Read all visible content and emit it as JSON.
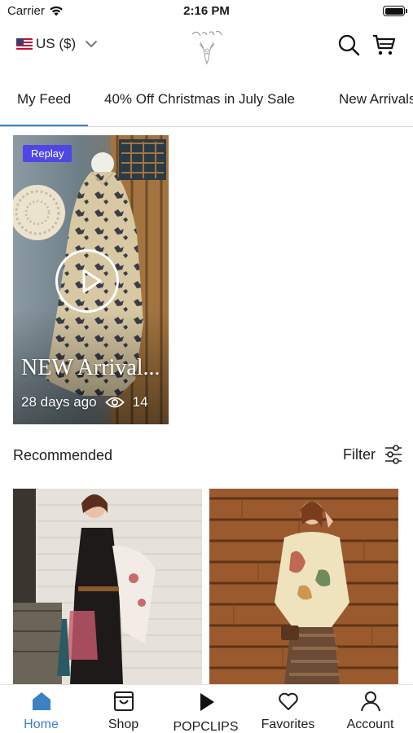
{
  "status_bar": {
    "carrier": "Carrier",
    "time": "2:16 PM"
  },
  "header": {
    "currency": "US ($)",
    "icons": [
      "flag-us-icon",
      "chevron-down-icon",
      "logo-icon",
      "search-icon",
      "cart-icon"
    ]
  },
  "tabs": [
    {
      "label": "My Feed",
      "active": true
    },
    {
      "label": "40% Off Christmas in July Sale",
      "active": false
    },
    {
      "label": "New Arrivals",
      "active": false
    }
  ],
  "replay": {
    "badge": "Replay",
    "title": "NEW Arrival...",
    "age": "28 days ago",
    "views": "14"
  },
  "recommended": {
    "title": "Recommended",
    "filter_label": "Filter"
  },
  "bottom_nav": [
    {
      "label": "Home",
      "icon": "home-icon",
      "active": true
    },
    {
      "label": "Shop",
      "icon": "shop-icon",
      "active": false
    },
    {
      "label": "POPCLIPS",
      "icon": "play-icon",
      "active": false
    },
    {
      "label": "Favorites",
      "icon": "heart-icon",
      "active": false
    },
    {
      "label": "Account",
      "icon": "account-icon",
      "active": false
    }
  ],
  "colors": {
    "accent": "#3b82c4",
    "badge": "#4f46e5",
    "tab_indicator": "#3b7fc4"
  }
}
